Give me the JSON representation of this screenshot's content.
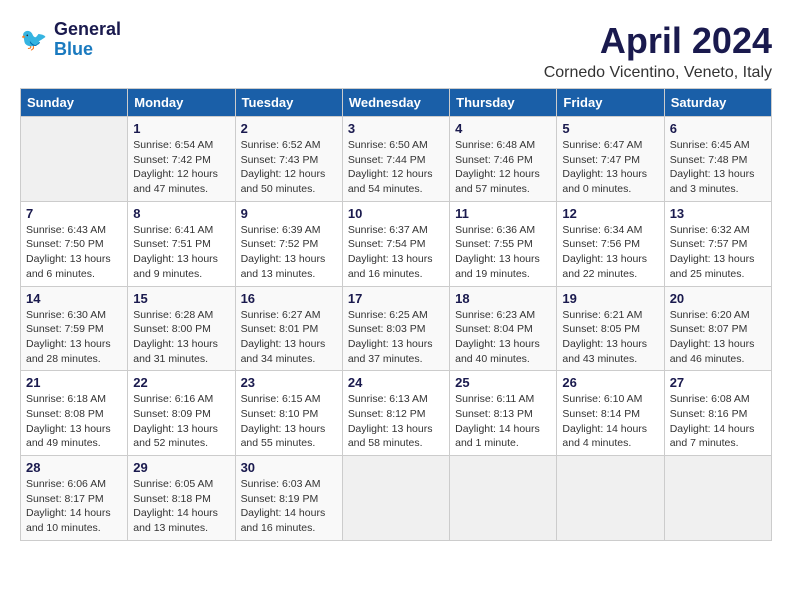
{
  "header": {
    "logo_line1": "General",
    "logo_line2": "Blue",
    "month": "April 2024",
    "location": "Cornedo Vicentino, Veneto, Italy"
  },
  "weekdays": [
    "Sunday",
    "Monday",
    "Tuesday",
    "Wednesday",
    "Thursday",
    "Friday",
    "Saturday"
  ],
  "weeks": [
    [
      {
        "day": "",
        "empty": true
      },
      {
        "day": "1",
        "sunrise": "Sunrise: 6:54 AM",
        "sunset": "Sunset: 7:42 PM",
        "daylight": "Daylight: 12 hours and 47 minutes."
      },
      {
        "day": "2",
        "sunrise": "Sunrise: 6:52 AM",
        "sunset": "Sunset: 7:43 PM",
        "daylight": "Daylight: 12 hours and 50 minutes."
      },
      {
        "day": "3",
        "sunrise": "Sunrise: 6:50 AM",
        "sunset": "Sunset: 7:44 PM",
        "daylight": "Daylight: 12 hours and 54 minutes."
      },
      {
        "day": "4",
        "sunrise": "Sunrise: 6:48 AM",
        "sunset": "Sunset: 7:46 PM",
        "daylight": "Daylight: 12 hours and 57 minutes."
      },
      {
        "day": "5",
        "sunrise": "Sunrise: 6:47 AM",
        "sunset": "Sunset: 7:47 PM",
        "daylight": "Daylight: 13 hours and 0 minutes."
      },
      {
        "day": "6",
        "sunrise": "Sunrise: 6:45 AM",
        "sunset": "Sunset: 7:48 PM",
        "daylight": "Daylight: 13 hours and 3 minutes."
      }
    ],
    [
      {
        "day": "7",
        "sunrise": "Sunrise: 6:43 AM",
        "sunset": "Sunset: 7:50 PM",
        "daylight": "Daylight: 13 hours and 6 minutes."
      },
      {
        "day": "8",
        "sunrise": "Sunrise: 6:41 AM",
        "sunset": "Sunset: 7:51 PM",
        "daylight": "Daylight: 13 hours and 9 minutes."
      },
      {
        "day": "9",
        "sunrise": "Sunrise: 6:39 AM",
        "sunset": "Sunset: 7:52 PM",
        "daylight": "Daylight: 13 hours and 13 minutes."
      },
      {
        "day": "10",
        "sunrise": "Sunrise: 6:37 AM",
        "sunset": "Sunset: 7:54 PM",
        "daylight": "Daylight: 13 hours and 16 minutes."
      },
      {
        "day": "11",
        "sunrise": "Sunrise: 6:36 AM",
        "sunset": "Sunset: 7:55 PM",
        "daylight": "Daylight: 13 hours and 19 minutes."
      },
      {
        "day": "12",
        "sunrise": "Sunrise: 6:34 AM",
        "sunset": "Sunset: 7:56 PM",
        "daylight": "Daylight: 13 hours and 22 minutes."
      },
      {
        "day": "13",
        "sunrise": "Sunrise: 6:32 AM",
        "sunset": "Sunset: 7:57 PM",
        "daylight": "Daylight: 13 hours and 25 minutes."
      }
    ],
    [
      {
        "day": "14",
        "sunrise": "Sunrise: 6:30 AM",
        "sunset": "Sunset: 7:59 PM",
        "daylight": "Daylight: 13 hours and 28 minutes."
      },
      {
        "day": "15",
        "sunrise": "Sunrise: 6:28 AM",
        "sunset": "Sunset: 8:00 PM",
        "daylight": "Daylight: 13 hours and 31 minutes."
      },
      {
        "day": "16",
        "sunrise": "Sunrise: 6:27 AM",
        "sunset": "Sunset: 8:01 PM",
        "daylight": "Daylight: 13 hours and 34 minutes."
      },
      {
        "day": "17",
        "sunrise": "Sunrise: 6:25 AM",
        "sunset": "Sunset: 8:03 PM",
        "daylight": "Daylight: 13 hours and 37 minutes."
      },
      {
        "day": "18",
        "sunrise": "Sunrise: 6:23 AM",
        "sunset": "Sunset: 8:04 PM",
        "daylight": "Daylight: 13 hours and 40 minutes."
      },
      {
        "day": "19",
        "sunrise": "Sunrise: 6:21 AM",
        "sunset": "Sunset: 8:05 PM",
        "daylight": "Daylight: 13 hours and 43 minutes."
      },
      {
        "day": "20",
        "sunrise": "Sunrise: 6:20 AM",
        "sunset": "Sunset: 8:07 PM",
        "daylight": "Daylight: 13 hours and 46 minutes."
      }
    ],
    [
      {
        "day": "21",
        "sunrise": "Sunrise: 6:18 AM",
        "sunset": "Sunset: 8:08 PM",
        "daylight": "Daylight: 13 hours and 49 minutes."
      },
      {
        "day": "22",
        "sunrise": "Sunrise: 6:16 AM",
        "sunset": "Sunset: 8:09 PM",
        "daylight": "Daylight: 13 hours and 52 minutes."
      },
      {
        "day": "23",
        "sunrise": "Sunrise: 6:15 AM",
        "sunset": "Sunset: 8:10 PM",
        "daylight": "Daylight: 13 hours and 55 minutes."
      },
      {
        "day": "24",
        "sunrise": "Sunrise: 6:13 AM",
        "sunset": "Sunset: 8:12 PM",
        "daylight": "Daylight: 13 hours and 58 minutes."
      },
      {
        "day": "25",
        "sunrise": "Sunrise: 6:11 AM",
        "sunset": "Sunset: 8:13 PM",
        "daylight": "Daylight: 14 hours and 1 minute."
      },
      {
        "day": "26",
        "sunrise": "Sunrise: 6:10 AM",
        "sunset": "Sunset: 8:14 PM",
        "daylight": "Daylight: 14 hours and 4 minutes."
      },
      {
        "day": "27",
        "sunrise": "Sunrise: 6:08 AM",
        "sunset": "Sunset: 8:16 PM",
        "daylight": "Daylight: 14 hours and 7 minutes."
      }
    ],
    [
      {
        "day": "28",
        "sunrise": "Sunrise: 6:06 AM",
        "sunset": "Sunset: 8:17 PM",
        "daylight": "Daylight: 14 hours and 10 minutes."
      },
      {
        "day": "29",
        "sunrise": "Sunrise: 6:05 AM",
        "sunset": "Sunset: 8:18 PM",
        "daylight": "Daylight: 14 hours and 13 minutes."
      },
      {
        "day": "30",
        "sunrise": "Sunrise: 6:03 AM",
        "sunset": "Sunset: 8:19 PM",
        "daylight": "Daylight: 14 hours and 16 minutes."
      },
      {
        "day": "",
        "empty": true
      },
      {
        "day": "",
        "empty": true
      },
      {
        "day": "",
        "empty": true
      },
      {
        "day": "",
        "empty": true
      }
    ]
  ]
}
